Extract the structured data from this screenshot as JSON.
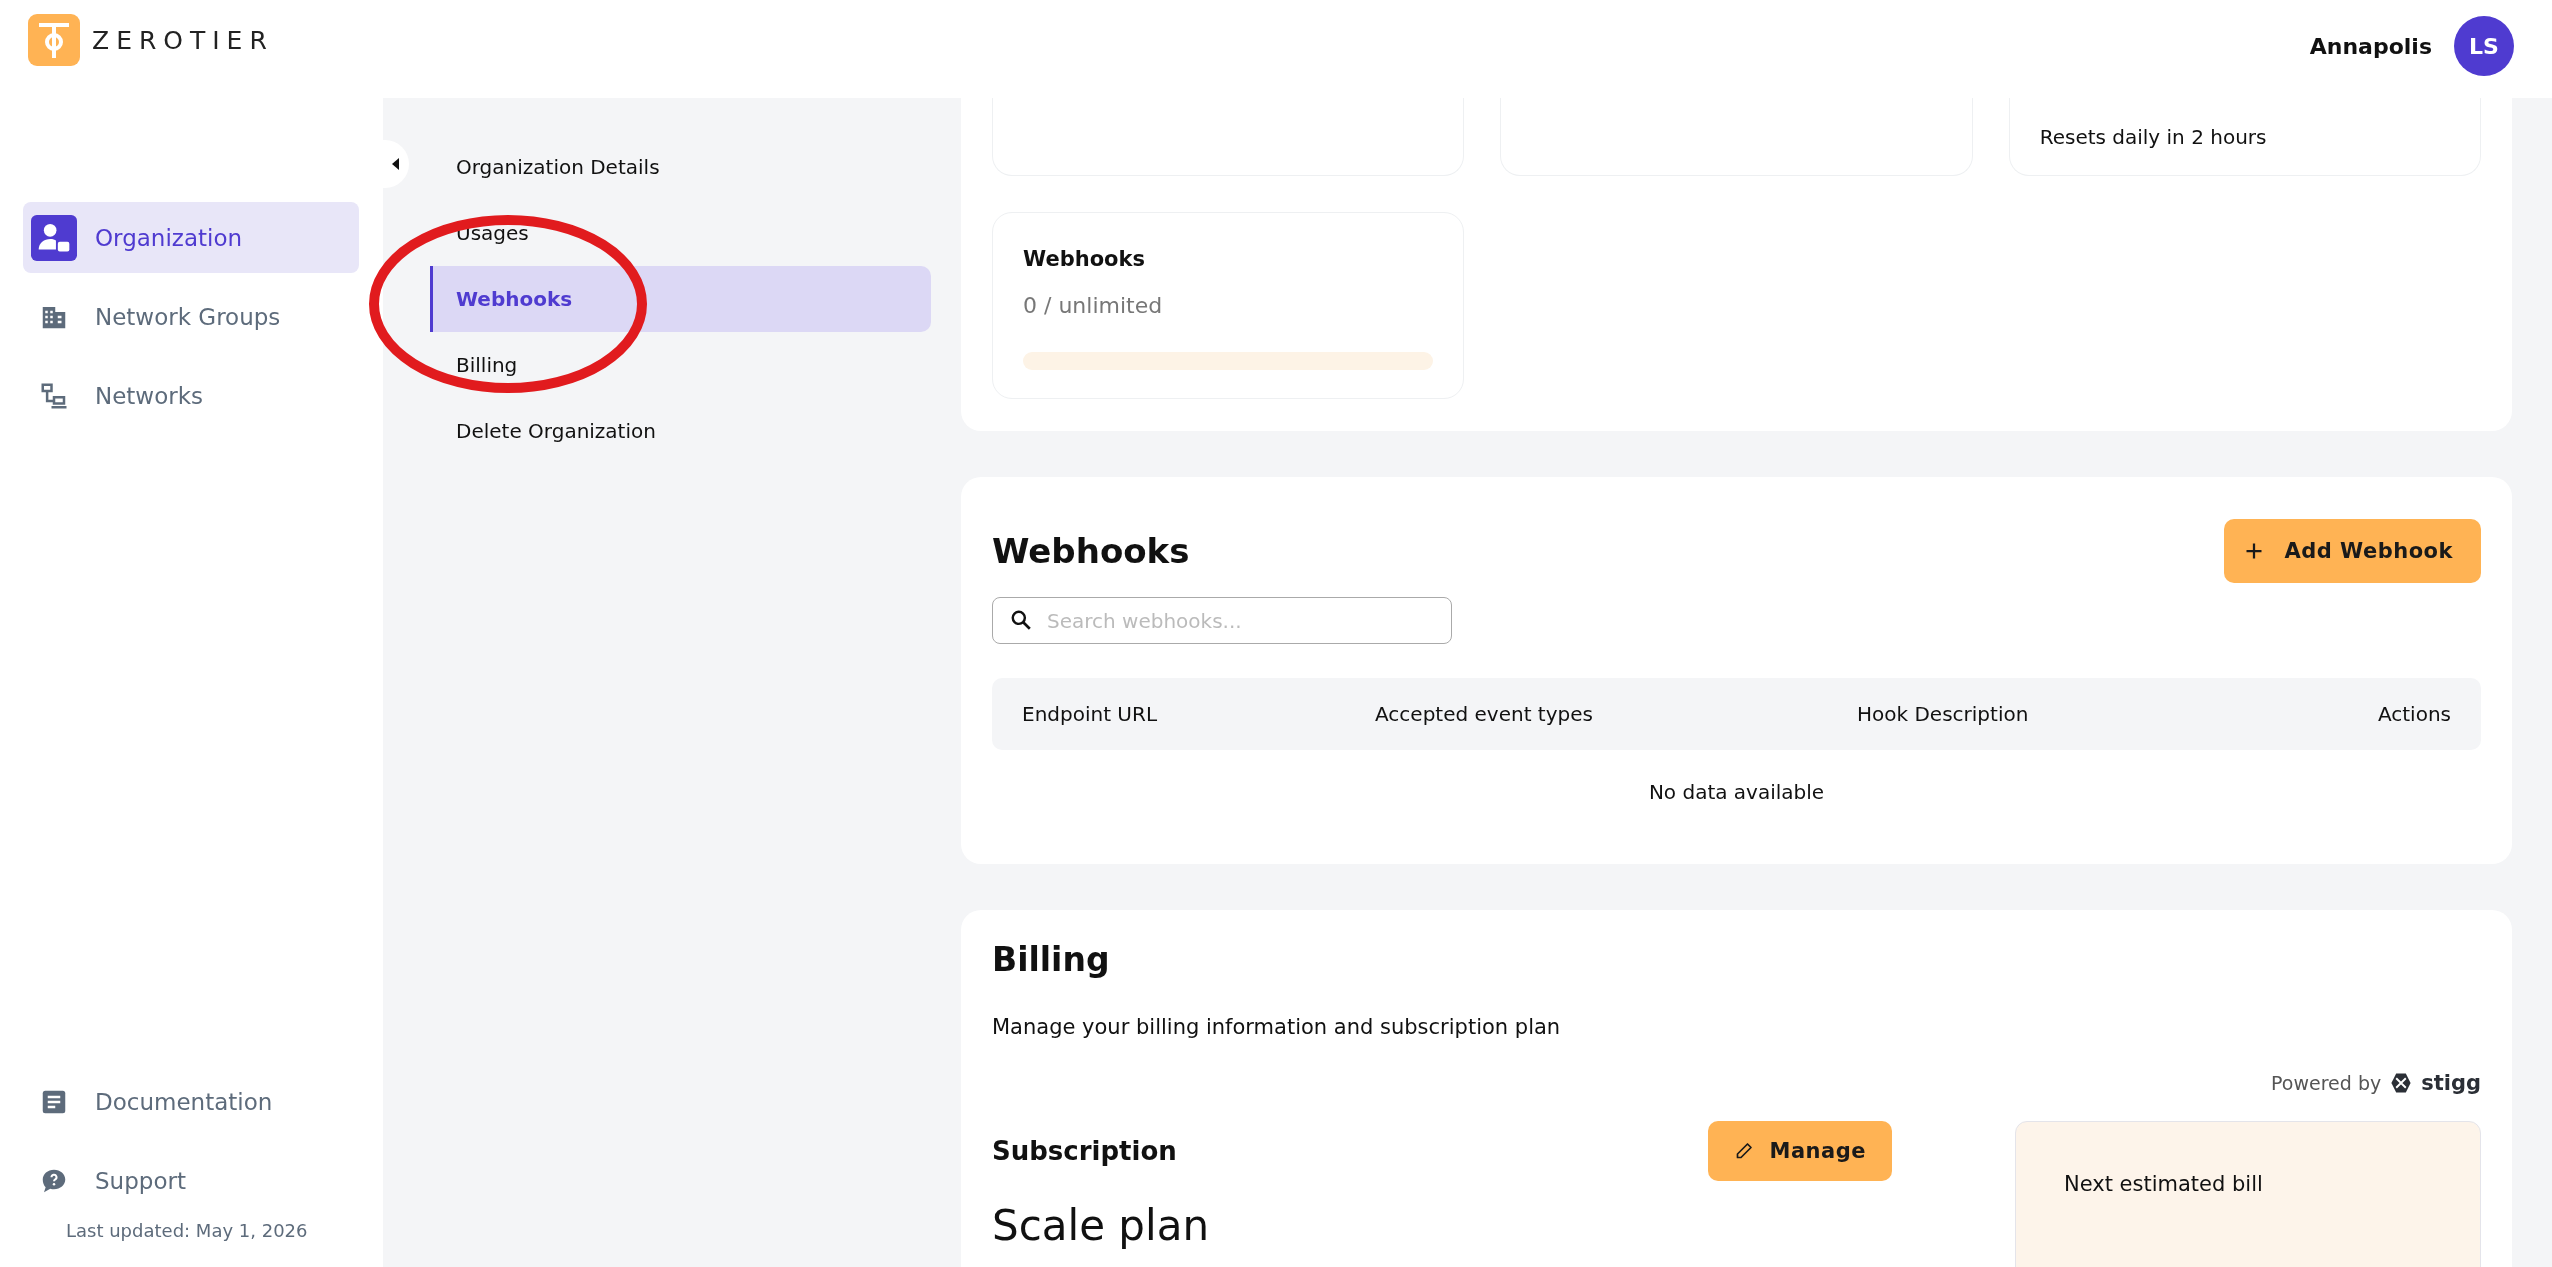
{
  "header": {
    "brand": "ZEROTIER",
    "user": {
      "name": "Annapolis",
      "initials": "LS"
    }
  },
  "sidebar": {
    "items": [
      {
        "label": "Organization",
        "kind": "org",
        "selected": true
      },
      {
        "label": "Network Groups",
        "kind": "building",
        "selected": false
      },
      {
        "label": "Networks",
        "kind": "network",
        "selected": false
      }
    ],
    "footer_items": [
      {
        "label": "Documentation",
        "kind": "doc"
      },
      {
        "label": "Support",
        "kind": "support"
      }
    ],
    "last_updated": "Last updated: May 1, 2026"
  },
  "subnav": {
    "items": [
      {
        "label": "Organization Details",
        "selected": false
      },
      {
        "label": "Usages",
        "selected": false
      },
      {
        "label": "Webhooks",
        "selected": true
      },
      {
        "label": "Billing",
        "selected": false
      },
      {
        "label": "Delete Organization",
        "selected": false
      }
    ]
  },
  "usage_cards": [
    {
      "kind": "blank"
    },
    {
      "kind": "blank"
    },
    {
      "kind": "note",
      "note": "Resets daily in 2 hours"
    },
    {
      "kind": "meter",
      "title": "Webhooks",
      "reading": "0 / unlimited",
      "level": 0
    }
  ],
  "webhooks": {
    "title": "Webhooks",
    "add_button": "Add Webhook",
    "search": {
      "placeholder": "Search webhooks..."
    },
    "table": {
      "columns": [
        "Endpoint URL",
        "Accepted event types",
        "Hook Description",
        "Actions"
      ],
      "empty_text": "No data available"
    }
  },
  "billing": {
    "title": "Billing",
    "description": "Manage your billing information and subscription plan",
    "powered_by": "Powered by",
    "vendor": "stigg",
    "subscription": {
      "title": "Subscription",
      "manage_button": "Manage",
      "plan": "Scale plan"
    },
    "next_bill": {
      "title": "Next estimated bill"
    }
  }
}
